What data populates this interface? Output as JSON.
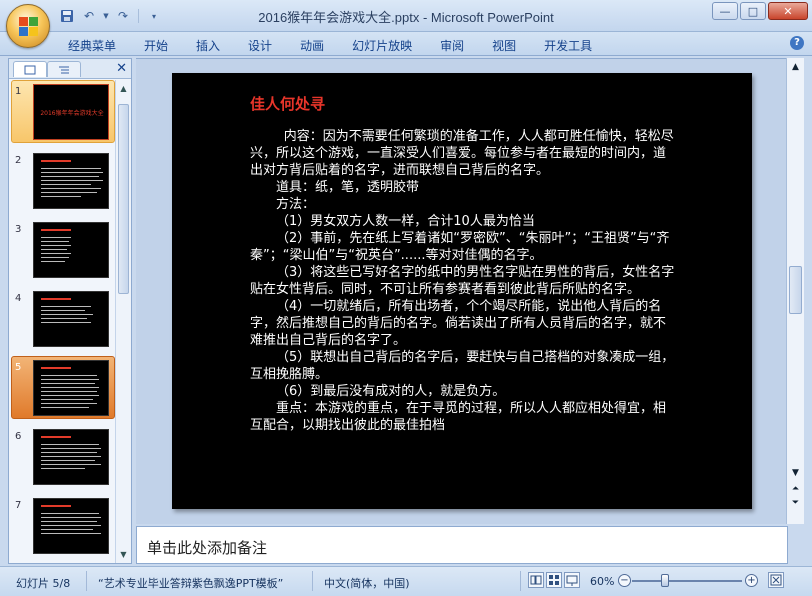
{
  "window": {
    "title": "2016猴年年会游戏大全.pptx - Microsoft PowerPoint",
    "controls": [
      "—",
      "□",
      "✕"
    ]
  },
  "quick_access": {
    "icons": [
      "save-icon",
      "undo-icon",
      "redo-icon",
      "customize-icon"
    ]
  },
  "ribbon": {
    "tabs": [
      "经典菜单",
      "开始",
      "插入",
      "设计",
      "动画",
      "幻灯片放映",
      "审阅",
      "视图",
      "开发工具"
    ],
    "help": "?"
  },
  "slides_panel": {
    "thumbnails": [
      {
        "num": "1",
        "cover_text": "2016猴年年会游戏大全"
      },
      {
        "num": "2"
      },
      {
        "num": "3"
      },
      {
        "num": "4"
      },
      {
        "num": "5"
      },
      {
        "num": "6"
      },
      {
        "num": "7"
      }
    ],
    "selected": 5
  },
  "slide": {
    "title": "佳人何处寻",
    "paragraphs": [
      "内容：因为不需要任何繁琐的准备工作，人人都可胜任愉快，轻松尽兴，所以这个游戏，一直深受人们喜爱。每位参与者在最短的时间内，道出对方背后贴着的名字，进而联想自己背后的名字。",
      "道具：纸，笔，透明胶带",
      "方法：",
      "（1）男女双方人数一样，合计10人最为恰当",
      "（2）事前，先在纸上写着诸如“罗密欧”、“朱丽叶”；“王祖贤”与“齐秦”；“梁山伯”与“祝英台”......等对对佳偶的名字。",
      "（3）将这些已写好名字的纸中的男性名字贴在男性的背后，女性名字贴在女性背后。同时，不可让所有参赛者看到彼此背后所贴的名字。",
      "（4）一切就绪后，所有出场者，个个竭尽所能，说出他人背后的名字，然后推想自己的背后的名字。倘若读出了所有人员背后的名字，就不难推出自己背后的名字了。",
      "（5）联想出自己背后的名字后，要赶快与自己搭档的对象凑成一组，互相挽胳膊。",
      "（6）到最后没有成对的人，就是负方。",
      "重点：本游戏的重点，在于寻觅的过程，所以人人都应相处得宜，相互配合，以期找出彼此的最佳拍档"
    ]
  },
  "notes": {
    "placeholder": "单击此处添加备注"
  },
  "status": {
    "slide_indicator": "幻灯片 5/8",
    "theme": "“艺术专业毕业答辩紫色飘逸PPT模板”",
    "language": "中文(简体，中国)",
    "zoom": "60%",
    "zoom_fraction": 0.3
  },
  "colors": {
    "slide_title": "#e8352a",
    "slide_background": "#000000",
    "ribbon_text": "#15428b",
    "selected_thumb": "#e07a2b"
  }
}
